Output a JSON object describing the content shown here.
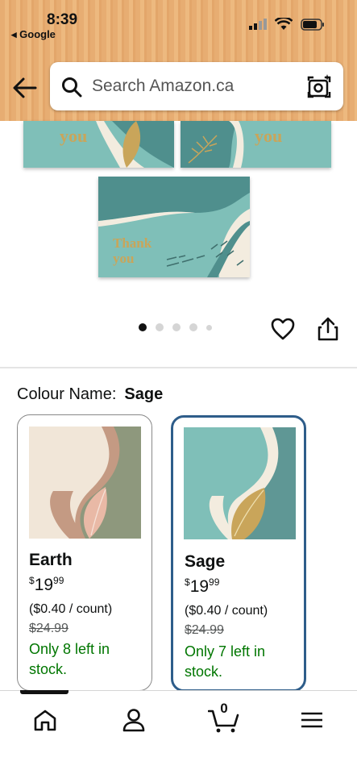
{
  "status_bar": {
    "time": "8:39",
    "back_app": "◂ Google"
  },
  "search": {
    "placeholder": "Search Amazon.ca"
  },
  "gallery": {
    "card_text": "Thank you",
    "card_text_partial_1": "Thank you",
    "card_text_partial_2": "thank you",
    "dots": 5,
    "active_dot": 0
  },
  "colour": {
    "label": "Colour Name:",
    "selected": "Sage"
  },
  "swatches": [
    {
      "name": "Earth",
      "price_whole": "19",
      "price_cents": "99",
      "currency": "$",
      "unit_price": "($0.40 / count)",
      "list_price": "$24.99",
      "stock": "Only 8 left in stock."
    },
    {
      "name": "Sage",
      "price_whole": "19",
      "price_cents": "99",
      "currency": "$",
      "unit_price": "($0.40 / count)",
      "list_price": "$24.99",
      "stock": "Only 7 left in stock."
    }
  ],
  "nav": {
    "cart_count": "0"
  },
  "colors": {
    "accent": "#2e5d8a",
    "stock_green": "#007600",
    "teal": "#7fbfb8",
    "dark_teal": "#4f8f8d",
    "header_orange": "#e7ad72"
  }
}
